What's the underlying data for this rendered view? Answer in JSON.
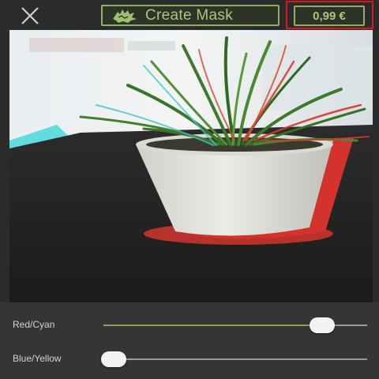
{
  "topbar": {
    "create_mask_label": "Create Mask",
    "price_label": "0,99 €"
  },
  "icons": {
    "close": "close-icon",
    "mask": "hand-mask-icon"
  },
  "sliders": [
    {
      "label": "Red/Cyan",
      "value": 0.83
    },
    {
      "label": "Blue/Yellow",
      "value": 0.04
    }
  ],
  "colors": {
    "accent": "#a9c77a",
    "accent_border": "#8faf63",
    "highlight": "#d01c1c",
    "slider_active": "#8aa64f",
    "slider_inactive": "#9a9a9a"
  }
}
